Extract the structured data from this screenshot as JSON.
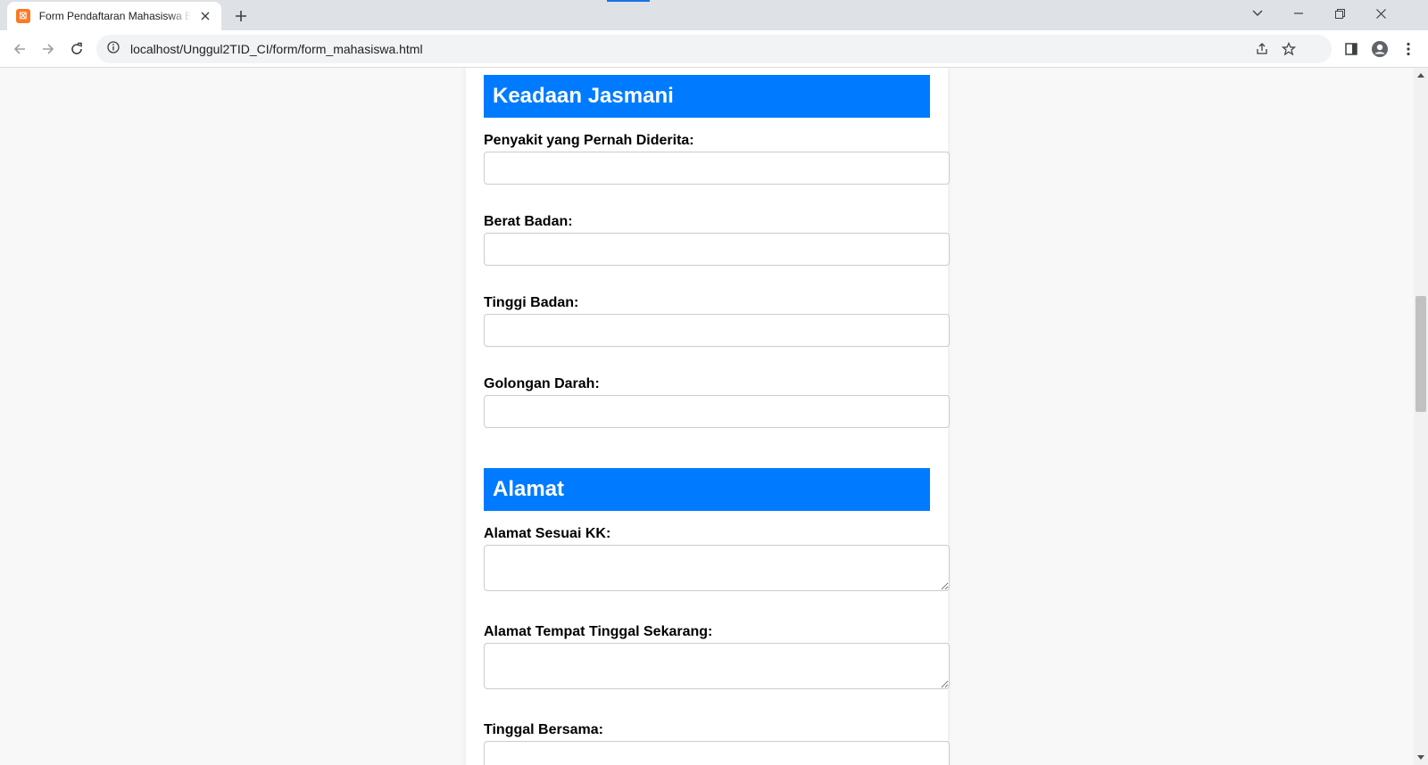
{
  "browser": {
    "tab_title": "Form Pendaftaran Mahasiswa Baru",
    "favicon_glyph": "☒",
    "url": "localhost/Unggul2TID_CI/form/form_mahasiswa.html",
    "accent": "#1a73e8"
  },
  "form": {
    "accent": "#007bff",
    "sections": {
      "jasmani": {
        "heading": "Keadaan Jasmani",
        "fields": {
          "penyakit": "Penyakit yang Pernah Diderita:",
          "berat": "Berat Badan:",
          "tinggi": "Tinggi Badan:",
          "golongan": "Golongan Darah:"
        }
      },
      "alamat": {
        "heading": "Alamat",
        "fields": {
          "alamat_kk": "Alamat Sesuai KK:",
          "alamat_sekarang": "Alamat Tempat Tinggal Sekarang:",
          "tinggal_bersama": "Tinggal Bersama:"
        }
      }
    }
  }
}
